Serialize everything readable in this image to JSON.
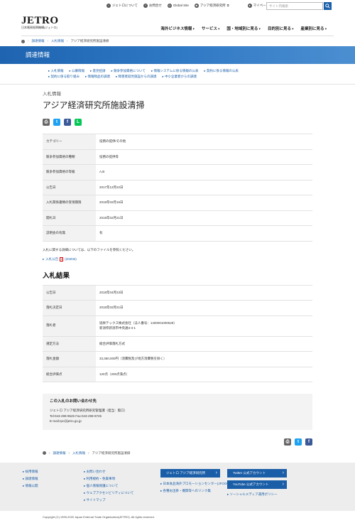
{
  "util": {
    "links": [
      "ジェトロについて",
      "お問合せ",
      "Global Site",
      "アジア経済研究所",
      "マイページ"
    ],
    "search_placeholder": "サイト内検索"
  },
  "logo": {
    "main": "JETRO",
    "sub": "日本貿易振興機構(ジェトロ)"
  },
  "gnav": [
    "海外ビジネス情報",
    "サービス",
    "国・地域別に見る",
    "目的別に見る",
    "産業別に見る"
  ],
  "breadcrumb": [
    "調達情報",
    "入札情報",
    "アジア経済研究所施設清掃"
  ],
  "band_title": "調達情報",
  "subnav": {
    "row1": [
      "入札情報",
      "公募情報",
      "意見招請",
      "競争参加資格について",
      "情報システムに係る情報の公表",
      "契約に係る情報の公表"
    ],
    "row2": [
      "契約に係る取り組み",
      "情報物品の調達",
      "障害者就労施設からの調達",
      "中小企業者からの調達"
    ]
  },
  "page": {
    "kicker": "入札情報",
    "title": "アジア経済研究所施設清掃"
  },
  "details": [
    {
      "k": "カテゴリー",
      "v": "役務の提供/その他"
    },
    {
      "k": "競争参加資格の種類",
      "v": "役務の提供等"
    },
    {
      "k": "競争参加資格の等級",
      "v": "A,B"
    },
    {
      "k": "公告日",
      "v": "2017年12月22日"
    },
    {
      "k": "入札関係書類の受領期限",
      "v": "2018年02月16日"
    },
    {
      "k": "開札日",
      "v": "2018年02月21日"
    },
    {
      "k": "説明会の有無",
      "v": "有"
    }
  ],
  "note": "入札に関する詳細については、以下のファイルを参照ください。",
  "file": {
    "label": "入札公告",
    "size": "(202KB)"
  },
  "result_heading": "入札結果",
  "results": [
    {
      "k": "公告日",
      "v": "2018年04月23日"
    },
    {
      "k": "落札決定日",
      "v": "2018年02月21日"
    },
    {
      "k": "落札者",
      "v": "協栄テックス株式会社（法人番号：1400001000528）",
      "v2": "新潟県新潟市中央通3-3-1",
      "tall": true
    },
    {
      "k": "選定方法",
      "v": "総合評価落札方式"
    },
    {
      "k": "落札金額",
      "v": "33,360,000円（消費税及び地方消費税を除く）"
    },
    {
      "k": "総合評価点",
      "v": "120点（200点満点）"
    }
  ],
  "contact": {
    "title": "この入札のお問い合わせ先",
    "lines": [
      "ジェトロ アジア経済研究所研究管理課（担当：阪口）",
      "Tel:043-299-9525 Fax:043-299-9725",
      "E-mail:rpc@jetro.go.jp"
    ]
  },
  "footer": {
    "col1": [
      "採用情報",
      "調達情報",
      "情報公開"
    ],
    "col2": [
      "お問い合わせ",
      "利用規約・免責事項",
      "個人情報保護について",
      "ウェブアクセシビリティについて",
      "サイトマップ"
    ],
    "btn_ide": "ジェトロ アジア経済研究所",
    "col3": [
      "日本食品海外プロモーションセンター(JFOODO)",
      "各種お出掛・機関等へのリンク集"
    ],
    "btn_twitter": "Twitter 公式アカウント",
    "btn_youtube": "YouTube 公式アカウント",
    "social_policy": "ソーシャルメディア運用ポリシー"
  },
  "copyright": "Copyright (C) 1995-2020 Japan External Trade Organization(JETRO). All rights reserved."
}
